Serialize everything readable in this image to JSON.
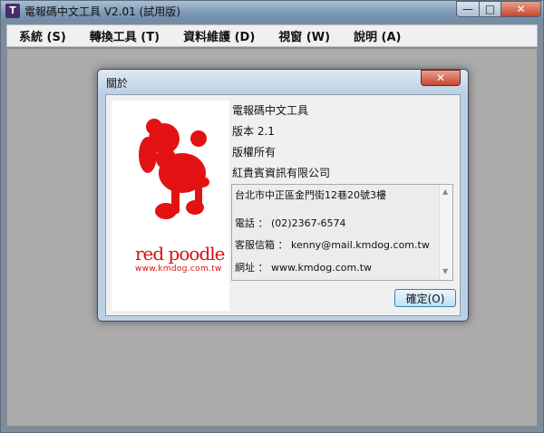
{
  "window": {
    "title": "電報碼中文工具 V2.01 (試用版)",
    "icon": "app-icon",
    "app_icon_glyph": "T",
    "controls": {
      "minimize": "—",
      "maximize": "□",
      "close": "✕"
    }
  },
  "menubar": [
    {
      "label": "系統 (S)"
    },
    {
      "label": "轉換工具 (T)"
    },
    {
      "label": "資料維護 (D)"
    },
    {
      "label": "視窗 (W)"
    },
    {
      "label": "說明 (A)"
    }
  ],
  "about_dialog": {
    "title": "關於",
    "close_glyph": "✕",
    "logo": {
      "text": "red poodle",
      "url": "www.kmdog.com.tw",
      "color": "#d81010"
    },
    "product_name": "電報碼中文工具",
    "version": "版本 2.1",
    "copyright": "版權所有",
    "company": "紅貴賓資訊有限公司",
    "contact": {
      "address": "台北市中正區金門街12巷20號3樓",
      "phone": "電話 ： (02)2367-6574",
      "email": "客服信箱 ： kenny@mail.kmdog.com.tw",
      "website": "網址  ： www.kmdog.com.tw"
    },
    "ok_label": "確定(O)"
  }
}
